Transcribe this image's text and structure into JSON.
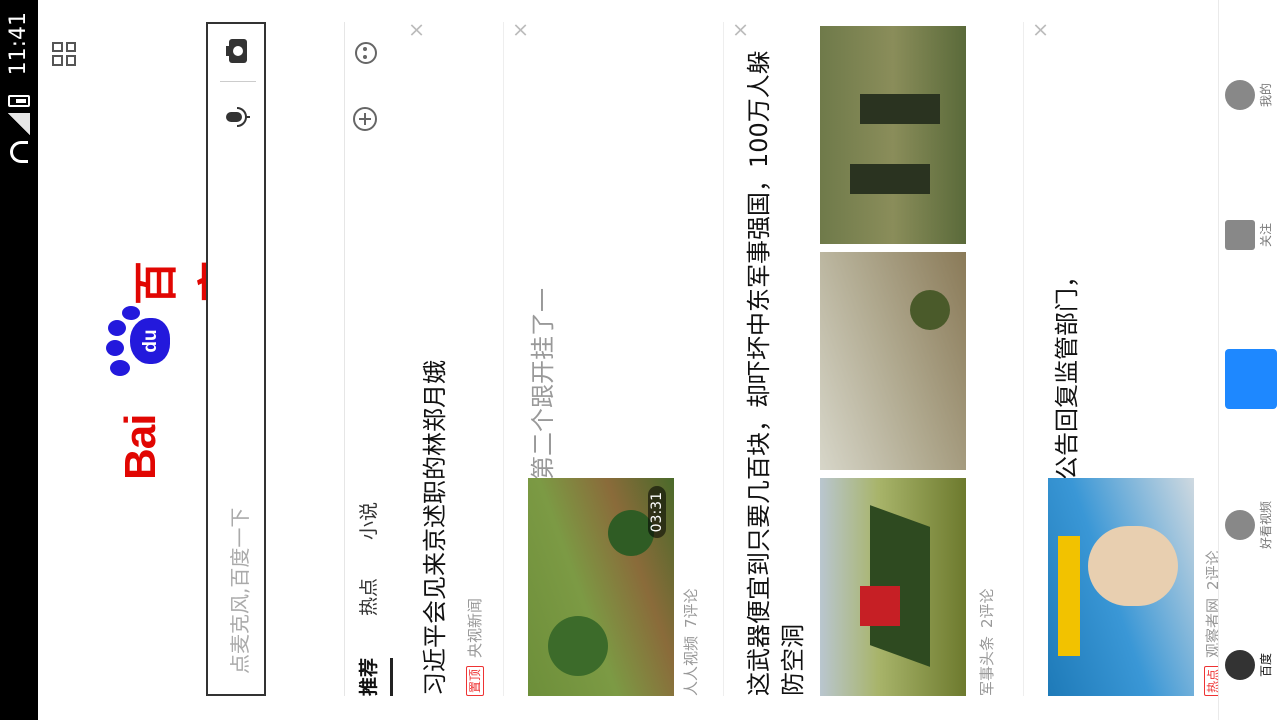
{
  "status_bar": {
    "time": "11:41"
  },
  "logo": {
    "bai": "Bai",
    "du": "du",
    "chinese": "百度"
  },
  "search": {
    "placeholder": "点麦克风,百度一下"
  },
  "tabs": [
    {
      "label": "推荐",
      "active": true
    },
    {
      "label": "热点",
      "active": false
    },
    {
      "label": "小说",
      "active": false
    }
  ],
  "feed": [
    {
      "title": "习近平会见来京述职的林郑月娥",
      "badge": "置顶",
      "source": "央视新闻",
      "comments": ""
    },
    {
      "title": "实拍西瓜收获过程，第二个跟开挂了一样，工资应该最高",
      "source": "人人视频",
      "comments": "7评论",
      "duration": "03:31"
    },
    {
      "title": "这武器便宜到只要几百块，却吓坏中东军事强国，100万人躲防空洞",
      "source": "军事头条",
      "comments": "2评论"
    },
    {
      "title": "莎普爱思两万字超长公告回复监管部门，称公司广告符合规定",
      "badge": "热点",
      "source": "观察者网",
      "comments": "2评论"
    }
  ],
  "bottom_nav": [
    {
      "label": "百度",
      "icon": "baidu-paw-icon",
      "active": true
    },
    {
      "label": "好看视频",
      "icon": "video-icon",
      "active": false
    },
    {
      "label": "",
      "icon": "voice-icon",
      "active": false
    },
    {
      "label": "关注",
      "icon": "follow-icon",
      "active": false
    },
    {
      "label": "我的",
      "icon": "person-icon",
      "active": false
    }
  ],
  "colors": {
    "brand_red": "#e10602",
    "brand_blue": "#2319dc",
    "accent_blue": "#1e88ff"
  }
}
